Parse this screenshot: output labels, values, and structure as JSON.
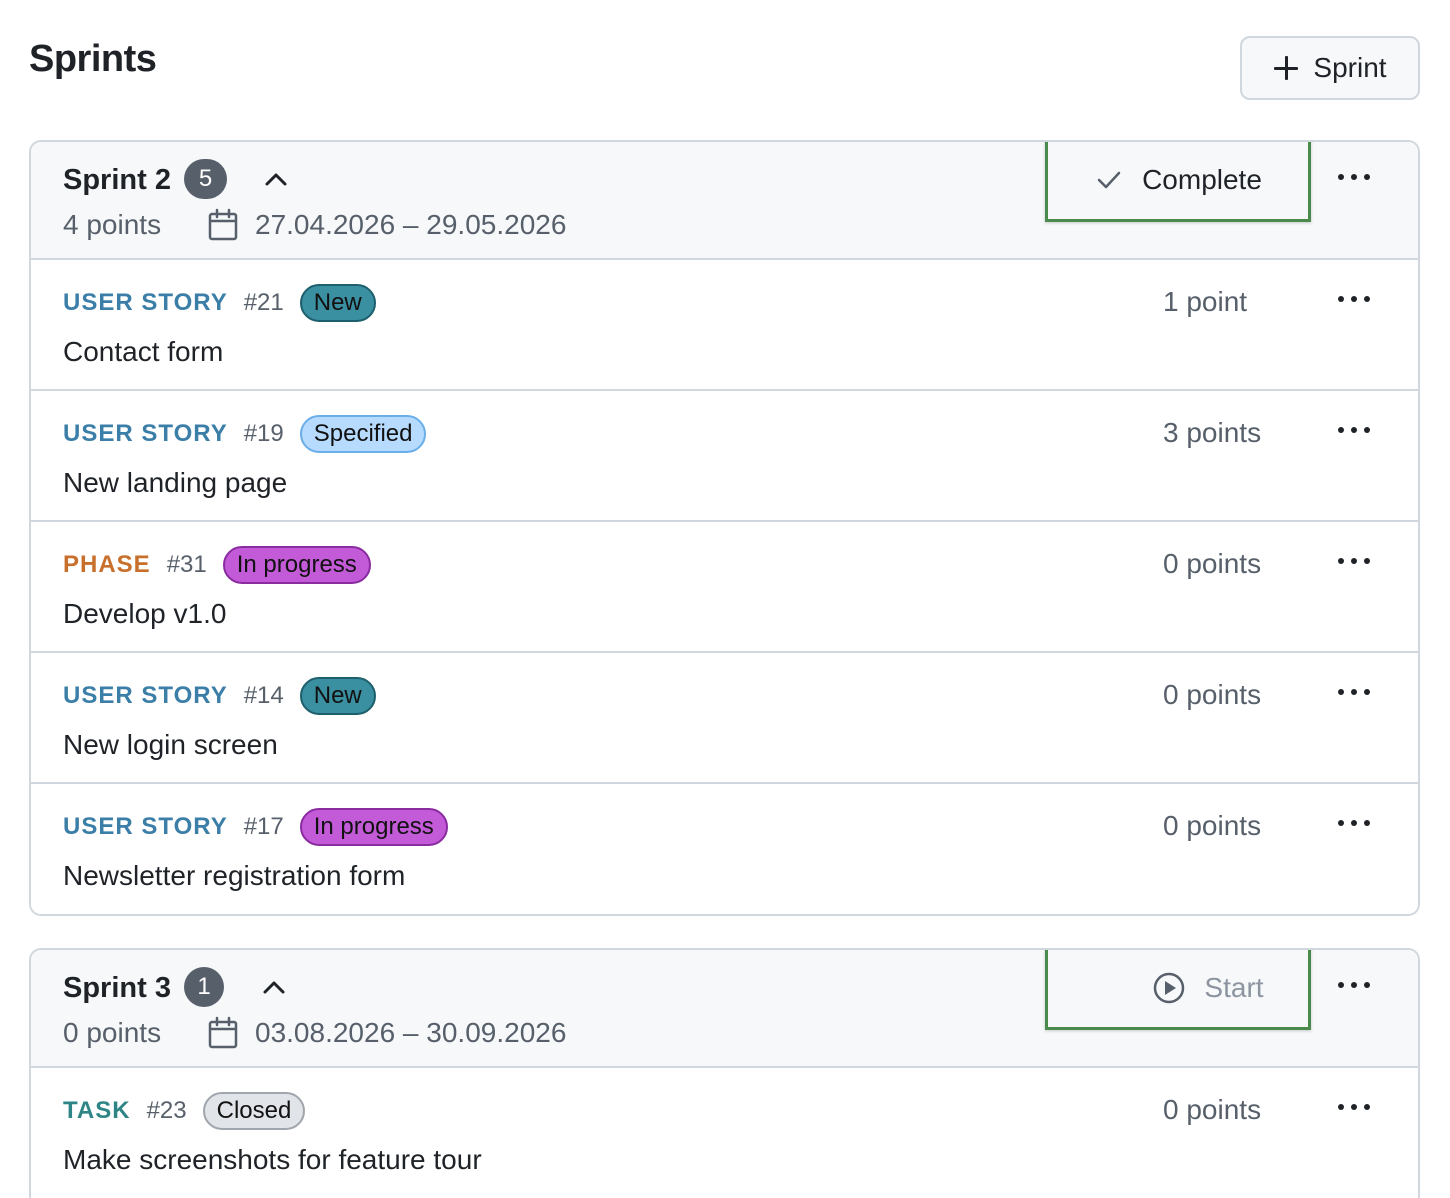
{
  "page": {
    "title": "Sprints",
    "add_sprint_label": "Sprint"
  },
  "colors": {
    "user_story": "#3b7ea8",
    "phase": "#c8702b",
    "task": "#2f8585",
    "status_new_bg": "#3a8fa0",
    "status_specified_bg": "#b6dbff",
    "status_in_progress_bg": "#c35ad8",
    "status_closed_bg": "#e1e4e8",
    "action_highlight": "#4a8a4a"
  },
  "sprints": [
    {
      "name": "Sprint 2",
      "count": "5",
      "points": "4 points",
      "dates": "27.04.2026 – 29.05.2026",
      "action_label": "Complete",
      "action_icon": "check-icon",
      "items": [
        {
          "type": "USER STORY",
          "type_key": "user_story",
          "id": "#21",
          "status": "New",
          "status_key": "new",
          "subject": "Contact form",
          "points": "1 point"
        },
        {
          "type": "USER STORY",
          "type_key": "user_story",
          "id": "#19",
          "status": "Specified",
          "status_key": "specified",
          "subject": "New landing page",
          "points": "3 points"
        },
        {
          "type": "PHASE",
          "type_key": "phase",
          "id": "#31",
          "status": "In progress",
          "status_key": "in_progress",
          "subject": "Develop v1.0",
          "points": "0 points"
        },
        {
          "type": "USER STORY",
          "type_key": "user_story",
          "id": "#14",
          "status": "New",
          "status_key": "new",
          "subject": "New login screen",
          "points": "0 points"
        },
        {
          "type": "USER STORY",
          "type_key": "user_story",
          "id": "#17",
          "status": "In progress",
          "status_key": "in_progress",
          "subject": "Newsletter registration form",
          "points": "0 points"
        }
      ]
    },
    {
      "name": "Sprint 3",
      "count": "1",
      "points": "0 points",
      "dates": "03.08.2026 – 30.09.2026",
      "action_label": "Start",
      "action_icon": "play-circle-icon",
      "items": [
        {
          "type": "TASK",
          "type_key": "task",
          "id": "#23",
          "status": "Closed",
          "status_key": "closed",
          "subject": "Make screenshots for feature tour",
          "points": "0 points"
        }
      ]
    }
  ]
}
